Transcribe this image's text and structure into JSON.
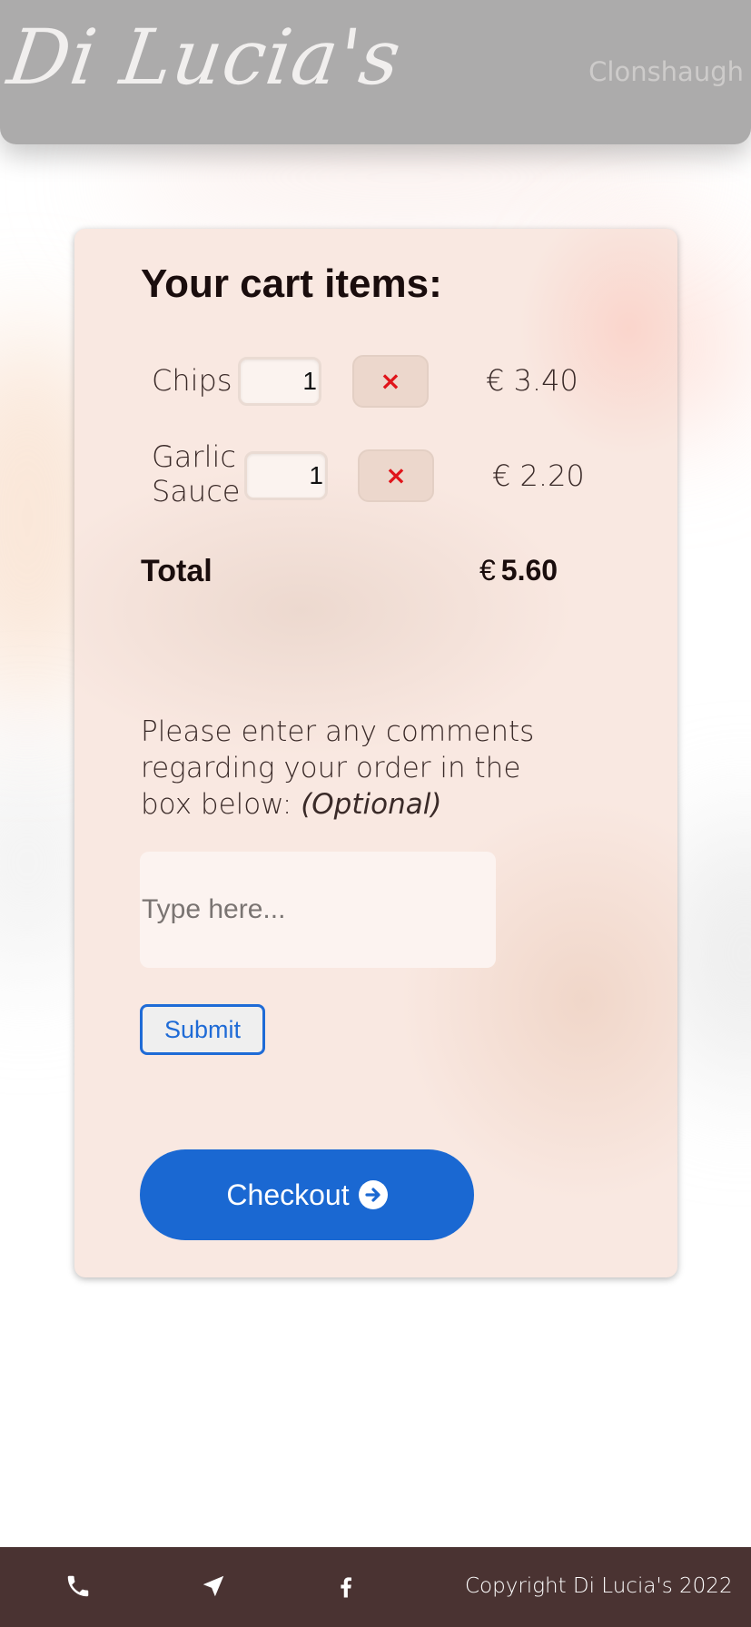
{
  "header": {
    "logo_text": "Di Lucia's",
    "location": "Clonshaugh"
  },
  "cart": {
    "title": "Your cart items:",
    "currency": "€",
    "items": [
      {
        "name": "Chips",
        "quantity": "1",
        "remove_label": "×",
        "price": "€ 3.40"
      },
      {
        "name": "Garlic Sauce",
        "quantity": "1",
        "remove_label": "×",
        "price": "€ 2.20"
      }
    ],
    "total_label": "Total",
    "total_currency": "€",
    "total_amount": "5.60"
  },
  "comments": {
    "prompt": "Please enter any comments regarding your order in the box below:",
    "optional_note": "(Optional)",
    "placeholder": "Type here...",
    "submit_label": "Submit"
  },
  "checkout": {
    "label": "Checkout",
    "icon": "arrow-circle-right-icon"
  },
  "footer": {
    "icons": [
      "phone-icon",
      "location-arrow-icon",
      "facebook-icon"
    ],
    "copyright": "Copyright Di Lucia's 2022"
  },
  "colors": {
    "header_bg": "#acabab",
    "card_bg": "#f9e8e1",
    "accent_blue": "#1a68d2",
    "remove_red": "#e0141a",
    "footer_bg": "#4a3332"
  }
}
